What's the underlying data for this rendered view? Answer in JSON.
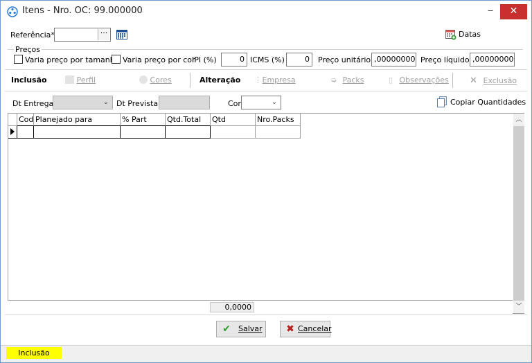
{
  "window": {
    "title": "Itens - Nro. OC: 99.000000",
    "minimize": "‒",
    "close": "✕"
  },
  "referencia": {
    "label": "Referência*",
    "value": "",
    "browse": "···",
    "datas_label": "Datas"
  },
  "precos": {
    "group_label": "Preços",
    "varia_tamanho": "Varia preço por tamanho",
    "varia_cor": "Varia preço por cor",
    "ipi_label": "IPI (%)",
    "ipi_value": "0",
    "icms_label": "ICMS (%)",
    "icms_value": "0",
    "unitario_label": "Preço unitário:",
    "unitario_value": ",000000000",
    "liquido_label": "Preço líquido:",
    "liquido_value": ",000000000"
  },
  "toolbar": {
    "inclusao": "Inclusão",
    "perfil": "Perfil",
    "cores": "Cores",
    "alteracao": "Alteração",
    "empresa": "Empresa",
    "packs": "Packs",
    "observacoes": "Observações",
    "exclusao": "Exclusão"
  },
  "filters": {
    "dt_entrega_label": "Dt Entrega",
    "dt_prevista_label": "Dt Prevista",
    "cor_label": "Cor",
    "copiar_label": "Copiar Quantidades"
  },
  "grid": {
    "columns": [
      "Cod",
      "Planejado para",
      "% Part",
      "Qtd.Total",
      "Qtd",
      "Nro.Packs"
    ],
    "total_qtd": "0,0000"
  },
  "buttons": {
    "salvar": "Salvar",
    "cancelar": "Cancelar"
  },
  "status": {
    "mode": "Inclusão",
    "mode_color": "#ffff00"
  }
}
